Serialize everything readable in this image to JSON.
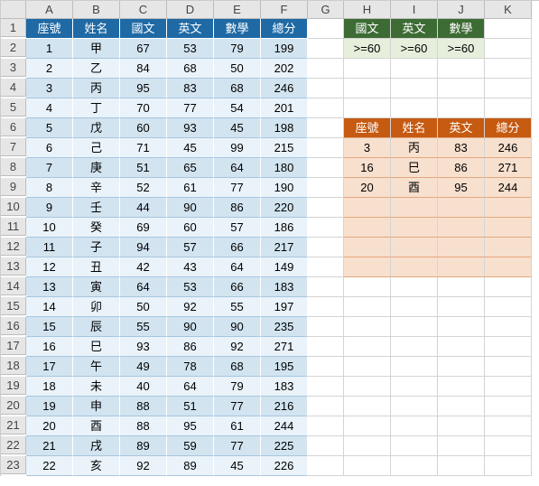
{
  "columns": [
    "A",
    "B",
    "C",
    "D",
    "E",
    "F",
    "G",
    "H",
    "I",
    "J",
    "K"
  ],
  "rowCount": 23,
  "main": {
    "headers": [
      "座號",
      "姓名",
      "國文",
      "英文",
      "數學",
      "總分"
    ],
    "rows": [
      [
        "1",
        "甲",
        "67",
        "53",
        "79",
        "199"
      ],
      [
        "2",
        "乙",
        "84",
        "68",
        "50",
        "202"
      ],
      [
        "3",
        "丙",
        "95",
        "83",
        "68",
        "246"
      ],
      [
        "4",
        "丁",
        "70",
        "77",
        "54",
        "201"
      ],
      [
        "5",
        "戊",
        "60",
        "93",
        "45",
        "198"
      ],
      [
        "6",
        "己",
        "71",
        "45",
        "99",
        "215"
      ],
      [
        "7",
        "庚",
        "51",
        "65",
        "64",
        "180"
      ],
      [
        "8",
        "辛",
        "52",
        "61",
        "77",
        "190"
      ],
      [
        "9",
        "壬",
        "44",
        "90",
        "86",
        "220"
      ],
      [
        "10",
        "癸",
        "69",
        "60",
        "57",
        "186"
      ],
      [
        "11",
        "子",
        "94",
        "57",
        "66",
        "217"
      ],
      [
        "12",
        "丑",
        "42",
        "43",
        "64",
        "149"
      ],
      [
        "13",
        "寅",
        "64",
        "53",
        "66",
        "183"
      ],
      [
        "14",
        "卯",
        "50",
        "92",
        "55",
        "197"
      ],
      [
        "15",
        "辰",
        "55",
        "90",
        "90",
        "235"
      ],
      [
        "16",
        "巳",
        "93",
        "86",
        "92",
        "271"
      ],
      [
        "17",
        "午",
        "49",
        "78",
        "68",
        "195"
      ],
      [
        "18",
        "未",
        "40",
        "64",
        "79",
        "183"
      ],
      [
        "19",
        "申",
        "88",
        "51",
        "77",
        "216"
      ],
      [
        "20",
        "酉",
        "88",
        "95",
        "61",
        "244"
      ],
      [
        "21",
        "戌",
        "89",
        "59",
        "77",
        "225"
      ],
      [
        "22",
        "亥",
        "92",
        "89",
        "45",
        "226"
      ]
    ]
  },
  "criteria": {
    "headers": [
      "國文",
      "英文",
      "數學"
    ],
    "values": [
      ">=60",
      ">=60",
      ">=60"
    ]
  },
  "result": {
    "headers": [
      "座號",
      "姓名",
      "英文",
      "總分"
    ],
    "rows": [
      [
        "3",
        "丙",
        "83",
        "246"
      ],
      [
        "16",
        "巳",
        "86",
        "271"
      ],
      [
        "20",
        "酉",
        "95",
        "244"
      ]
    ],
    "emptyRows": 4
  },
  "chart_data": {
    "type": "table",
    "title": "",
    "categories": [
      "座號",
      "姓名",
      "國文",
      "英文",
      "數學",
      "總分"
    ],
    "series": [
      {
        "name": "row1",
        "values": [
          1,
          "甲",
          67,
          53,
          79,
          199
        ]
      },
      {
        "name": "row2",
        "values": [
          2,
          "乙",
          84,
          68,
          50,
          202
        ]
      },
      {
        "name": "row3",
        "values": [
          3,
          "丙",
          95,
          83,
          68,
          246
        ]
      },
      {
        "name": "row4",
        "values": [
          4,
          "丁",
          70,
          77,
          54,
          201
        ]
      },
      {
        "name": "row5",
        "values": [
          5,
          "戊",
          60,
          93,
          45,
          198
        ]
      },
      {
        "name": "row6",
        "values": [
          6,
          "己",
          71,
          45,
          99,
          215
        ]
      },
      {
        "name": "row7",
        "values": [
          7,
          "庚",
          51,
          65,
          64,
          180
        ]
      },
      {
        "name": "row8",
        "values": [
          8,
          "辛",
          52,
          61,
          77,
          190
        ]
      },
      {
        "name": "row9",
        "values": [
          9,
          "壬",
          44,
          90,
          86,
          220
        ]
      },
      {
        "name": "row10",
        "values": [
          10,
          "癸",
          69,
          60,
          57,
          186
        ]
      },
      {
        "name": "row11",
        "values": [
          11,
          "子",
          94,
          57,
          66,
          217
        ]
      },
      {
        "name": "row12",
        "values": [
          12,
          "丑",
          42,
          43,
          64,
          149
        ]
      },
      {
        "name": "row13",
        "values": [
          13,
          "寅",
          64,
          53,
          66,
          183
        ]
      },
      {
        "name": "row14",
        "values": [
          14,
          "卯",
          50,
          92,
          55,
          197
        ]
      },
      {
        "name": "row15",
        "values": [
          15,
          "辰",
          55,
          90,
          90,
          235
        ]
      },
      {
        "name": "row16",
        "values": [
          16,
          "巳",
          93,
          86,
          92,
          271
        ]
      },
      {
        "name": "row17",
        "values": [
          17,
          "午",
          49,
          78,
          68,
          195
        ]
      },
      {
        "name": "row18",
        "values": [
          18,
          "未",
          40,
          64,
          79,
          183
        ]
      },
      {
        "name": "row19",
        "values": [
          19,
          "申",
          88,
          51,
          77,
          216
        ]
      },
      {
        "name": "row20",
        "values": [
          20,
          "酉",
          88,
          95,
          61,
          244
        ]
      },
      {
        "name": "row21",
        "values": [
          21,
          "戌",
          89,
          59,
          77,
          225
        ]
      },
      {
        "name": "row22",
        "values": [
          22,
          "亥",
          92,
          89,
          45,
          226
        ]
      }
    ]
  }
}
